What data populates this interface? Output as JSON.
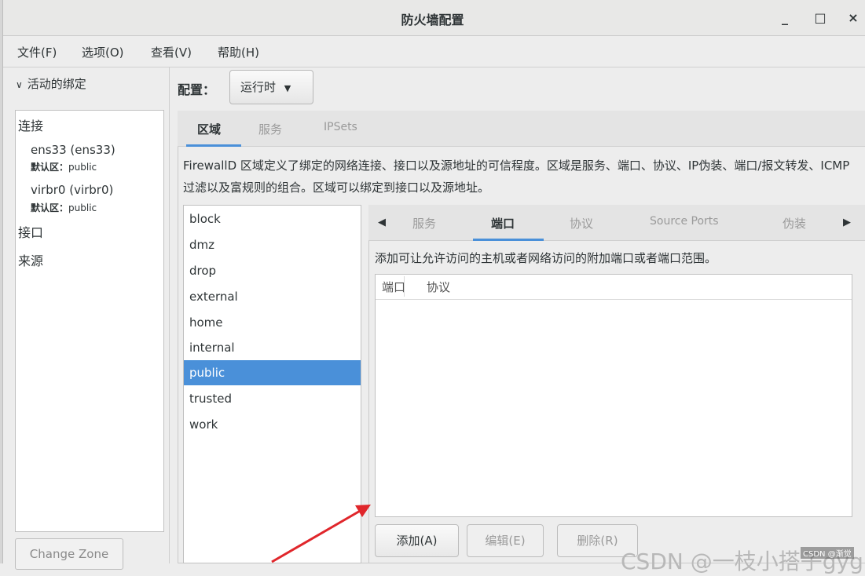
{
  "window": {
    "title": "防火墙配置",
    "minimize": "_",
    "maximize": "□",
    "close": "×"
  },
  "menubar": [
    "文件(F)",
    "选项(O)",
    "查看(V)",
    "帮助(H)"
  ],
  "left_panel": {
    "header": "活动的绑定",
    "connections_label": "连接",
    "connections": [
      {
        "name": "ens33 (ens33)",
        "zone_prefix": "默认区：",
        "zone": "public"
      },
      {
        "name": "virbr0 (virbr0)",
        "zone_prefix": "默认区：",
        "zone": "public"
      }
    ],
    "interfaces_label": "接口",
    "sources_label": "来源",
    "change_zone": "Change Zone"
  },
  "config": {
    "label": "配置：",
    "value": "运行时"
  },
  "tabs": [
    "区域",
    "服务",
    "IPSets"
  ],
  "zones_description": "FirewallD 区域定义了绑定的网络连接、接口以及源地址的可信程度。区域是服务、端口、协议、IP伪装、端口/报文转发、ICMP过滤以及富规则的组合。区域可以绑定到接口以及源地址。",
  "zones": [
    "block",
    "dmz",
    "drop",
    "external",
    "home",
    "internal",
    "public",
    "trusted",
    "work"
  ],
  "selected_zone": "public",
  "inner_tabs": [
    "服务",
    "端口",
    "协议",
    "Source Ports",
    "伪装"
  ],
  "active_inner_tab": "端口",
  "ports": {
    "description": "添加可让允许访问的主机或者网络访问的附加端口或者端口范围。",
    "columns": [
      "端口",
      "协议"
    ],
    "rows": []
  },
  "buttons": {
    "add": "添加(A)",
    "edit": "编辑(E)",
    "remove": "删除(R)"
  },
  "watermark": "CSDN @一枝小搭子gyg",
  "csdn_tag": "CSDN @渐觉",
  "colors": {
    "selection": "#4a90d9",
    "tab_underline": "#4a90d9",
    "arrow": "#e0262b"
  }
}
